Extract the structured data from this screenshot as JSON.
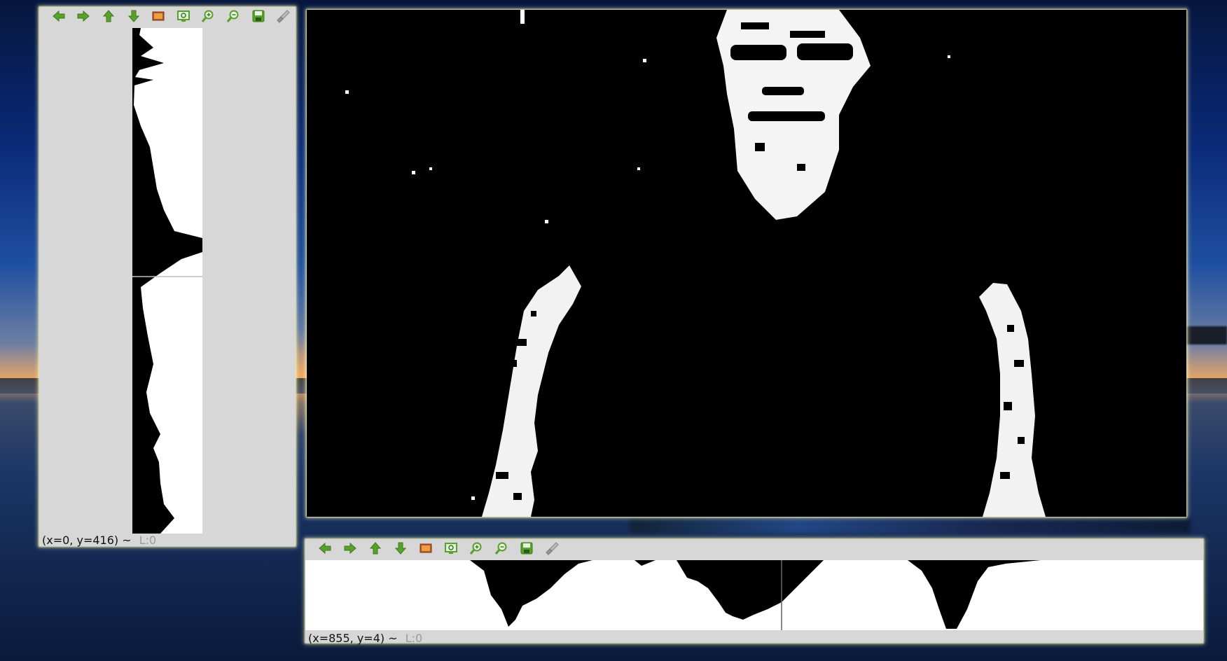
{
  "left_window": {
    "toolbar": [
      {
        "name": "back-arrow-icon",
        "label": "Back"
      },
      {
        "name": "forward-arrow-icon",
        "label": "Forward"
      },
      {
        "name": "up-arrow-icon",
        "label": "Up"
      },
      {
        "name": "down-arrow-icon",
        "label": "Down"
      },
      {
        "name": "image-icon",
        "label": "Image"
      },
      {
        "name": "zoom-fit-icon",
        "label": "Zoom fit"
      },
      {
        "name": "zoom-in-icon",
        "label": "Zoom in"
      },
      {
        "name": "zoom-out-icon",
        "label": "Zoom out"
      },
      {
        "name": "save-icon",
        "label": "Save"
      },
      {
        "name": "brush-icon",
        "label": "Brush"
      }
    ],
    "status_coords": "(x=0, y=416) ~",
    "status_value": "L:0"
  },
  "bottom_window": {
    "status_coords": "(x=855, y=4) ~",
    "status_value": "L:0"
  },
  "colors": {
    "toolbar_icon_green": "#5aa02c",
    "window_bg": "#d7d7d7",
    "plot_fill": "#ffffff",
    "plot_bg": "#000000"
  }
}
